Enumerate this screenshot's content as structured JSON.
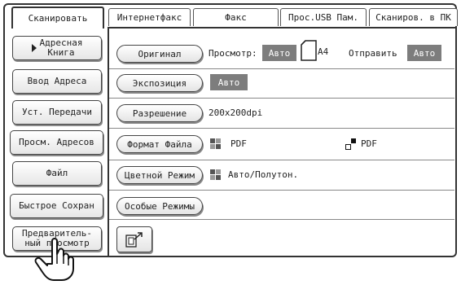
{
  "tabs": [
    "Сканировать",
    "Интернетфакс",
    "Факс",
    "Прос.USB Пам.",
    "Сканиров. в ПК"
  ],
  "left_buttons": {
    "address_book": [
      "Адресная",
      "Книга"
    ],
    "enter_address": "Ввод Адреса",
    "send_settings": "Уст. Передачи",
    "address_review": "Просм. Адресов",
    "file": "Файл",
    "quick_save": "Быстрое Сохран",
    "preview": [
      "Предваритель-",
      "ный просмотр"
    ]
  },
  "original": {
    "button": "Оригинал",
    "preview_label": "Просмотр:",
    "preview_value": "Авто",
    "paper_size": "A4",
    "send_label": "Отправить",
    "send_value": "Авто"
  },
  "exposure": {
    "button": "Экспозиция",
    "value": "Авто"
  },
  "resolution": {
    "button": "Разрешение",
    "value": "200x200dpi"
  },
  "file_format": {
    "button": "Формат Файла",
    "value_color": "PDF",
    "value_bw": "PDF"
  },
  "color_mode": {
    "button": "Цветной Режим",
    "value": "Авто/Полутон."
  },
  "special_modes": {
    "button": "Особые Режимы"
  },
  "icons": {
    "export": "export-icon",
    "original_page": "page-icon",
    "color_mode": "color-grid-icon",
    "bw_format": "bw-squares-icon",
    "cursor": "hand-pointer-icon"
  },
  "colors": {
    "badge": "#7d7d7d",
    "border": "#333333"
  }
}
